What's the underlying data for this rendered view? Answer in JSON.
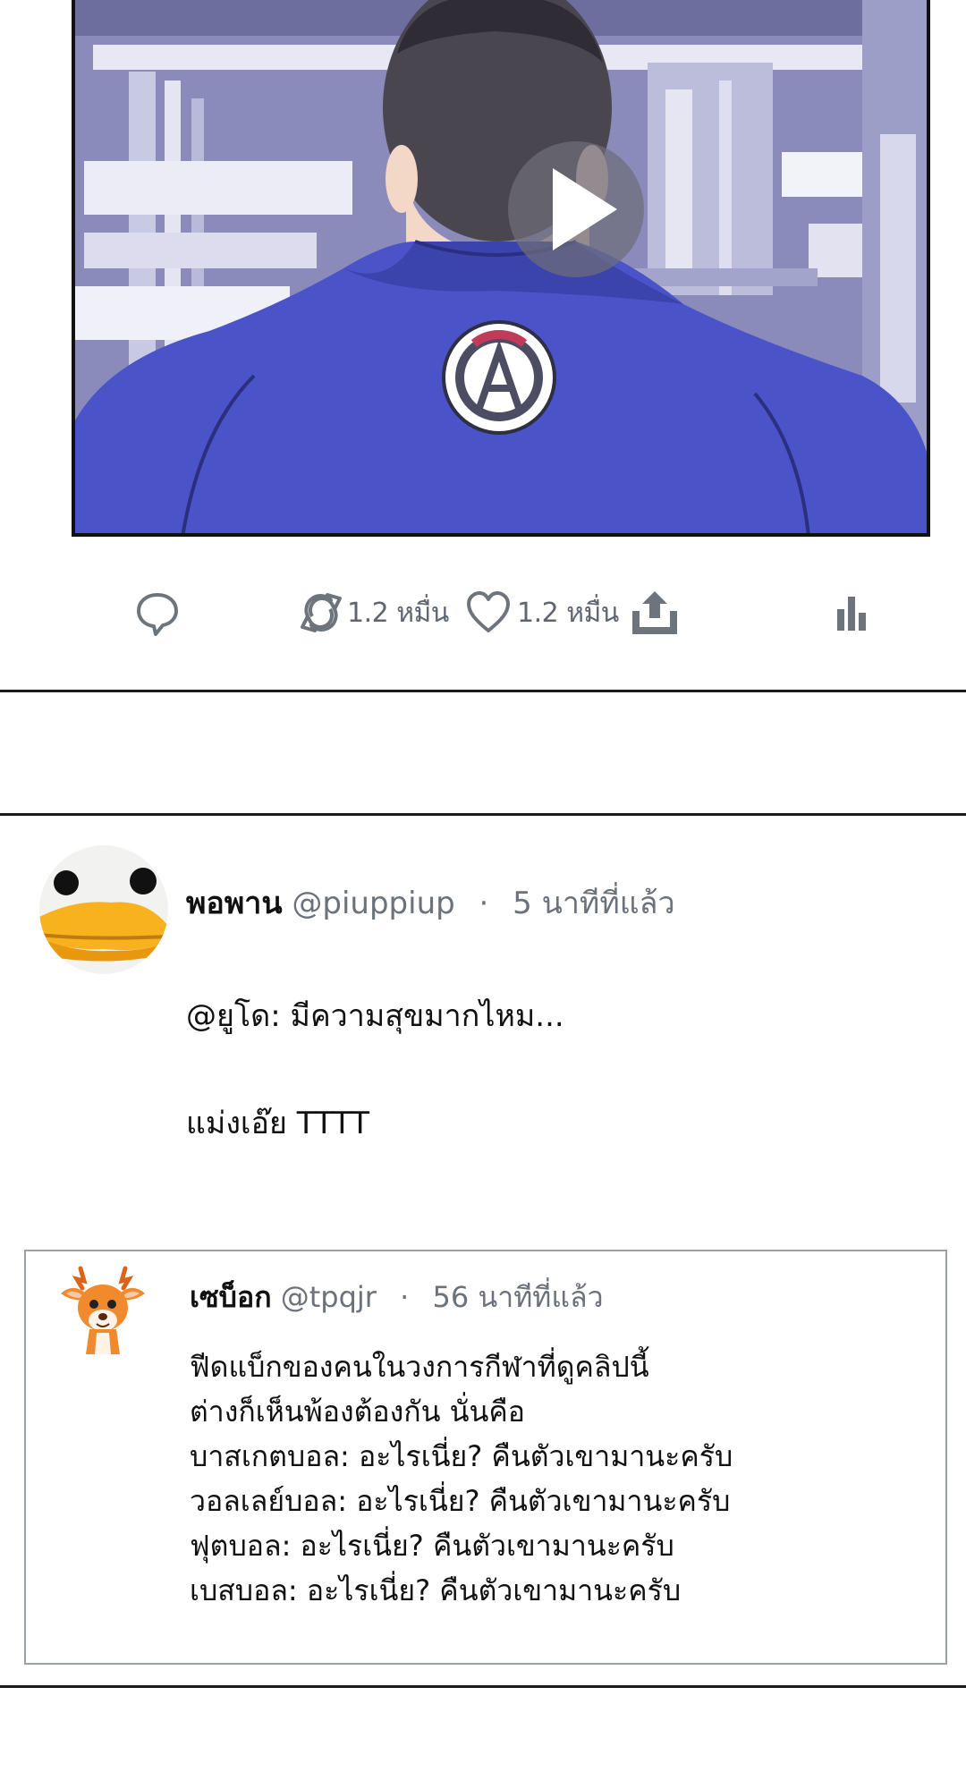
{
  "video": {
    "play_icon": "play-icon"
  },
  "actions": {
    "reply_icon": "comment-icon",
    "retweet_icon": "retweet-icon",
    "retweet_count": "1.2 หมื่น",
    "like_icon": "heart-icon",
    "like_count": "1.2 หมื่น",
    "share_icon": "share-icon",
    "analytics_icon": "analytics-icon"
  },
  "tweet": {
    "avatar": "duck-avatar",
    "display_name": "พอพาน",
    "handle": "@piuppiup",
    "separator": "·",
    "time": "5 นาทีที่แล้ว",
    "lines": [
      "@ยูโด: มีความสุขมากไหม...",
      "แม่งเอ๊ย TTTT"
    ]
  },
  "quote": {
    "avatar": "deer-avatar",
    "display_name": "เซบ็อก",
    "handle": "@tpqjr",
    "separator": "·",
    "time": "56 นาทีที่แล้ว",
    "lines": [
      "ฟีดแบ็กของคนในวงการกีฬาที่ดูคลิปนี้",
      "ต่างก็เห็นพ้องต้องกัน นั่นคือ",
      "บาสเกตบอล: อะไรเนี่ย? คืนตัวเขามานะครับ",
      "วอลเลย์บอล: อะไรเนี่ย? คืนตัวเขามานะครับ",
      "ฟุตบอล: อะไรเนี่ย? คืนตัวเขามานะครับ",
      "เบสบอล: อะไรเนี่ย? คืนตัวเขามานะครับ"
    ]
  },
  "colors": {
    "jacket": "#4a53c8",
    "background_tint": "#8f90c0",
    "meta_gray": "#6b727b"
  }
}
